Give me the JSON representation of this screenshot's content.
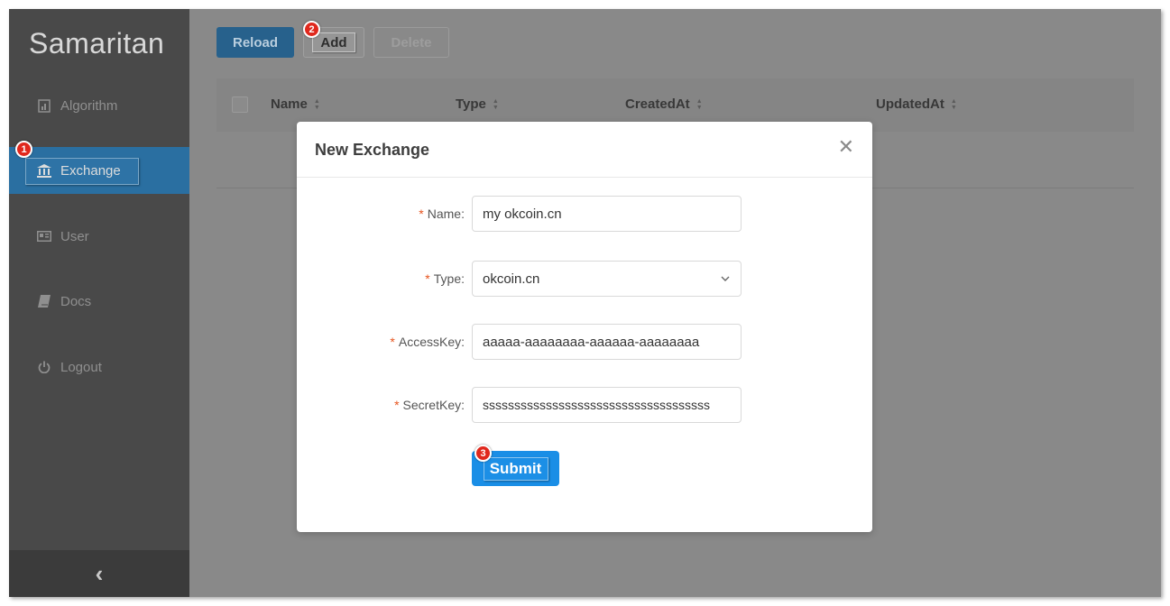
{
  "app": {
    "title": "Samaritan"
  },
  "sidebar": {
    "items": [
      {
        "label": "Algorithm",
        "icon": "chart-doc-icon"
      },
      {
        "label": "Exchange",
        "icon": "bank-icon"
      },
      {
        "label": "User",
        "icon": "id-card-icon"
      },
      {
        "label": "Docs",
        "icon": "book-icon"
      },
      {
        "label": "Logout",
        "icon": "power-icon"
      }
    ],
    "active_index": 1,
    "collapse_symbol": "‹"
  },
  "toolbar": {
    "reload_label": "Reload",
    "add_label": "Add",
    "delete_label": "Delete"
  },
  "table": {
    "columns": [
      "Name",
      "Type",
      "CreatedAt",
      "UpdatedAt"
    ]
  },
  "modal": {
    "title": "New Exchange",
    "close_symbol": "✕",
    "fields": [
      {
        "label": "Name",
        "value": "my okcoin.cn",
        "required": true
      },
      {
        "label": "Type",
        "value": "okcoin.cn",
        "required": true,
        "type": "select"
      },
      {
        "label": "AccessKey",
        "value": "aaaaa-aaaaaaaa-aaaaaa-aaaaaaaa",
        "required": true
      },
      {
        "label": "SecretKey",
        "value": "ssssssssssssssssssssssssssssssssssss",
        "required": true
      }
    ],
    "submit_label": "Submit"
  },
  "steps": [
    "1",
    "2",
    "3"
  ],
  "colors": {
    "sidebar": "#494949",
    "active": "#2a6fa1",
    "primary": "#1a8ee6",
    "required": "#e7541e",
    "marker": "#e0281d"
  }
}
